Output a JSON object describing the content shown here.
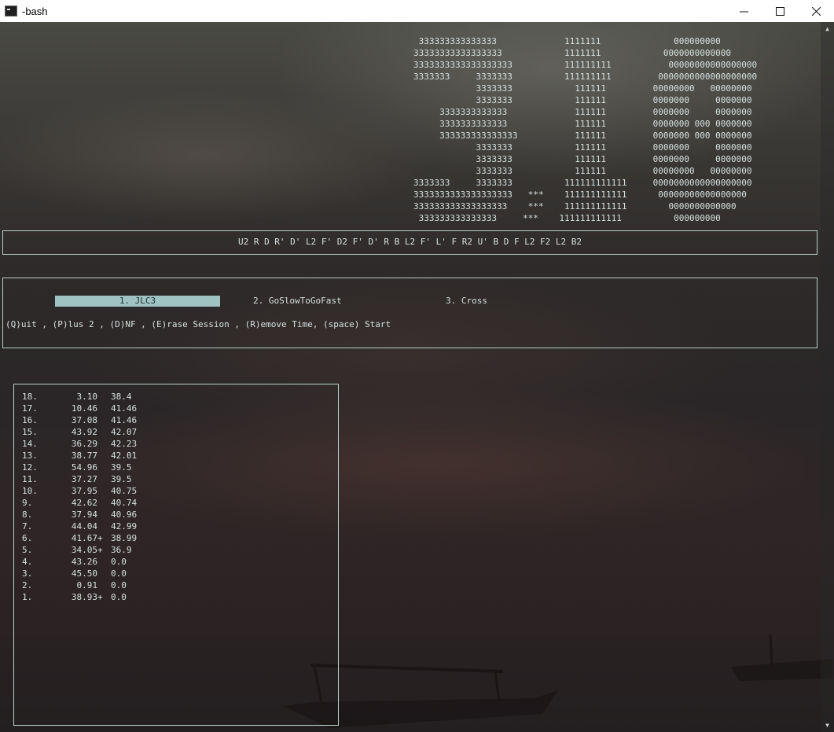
{
  "window": {
    "title": "-bash"
  },
  "logo": {
    "lines": [
      "                                                                                             333333333333333             1111111              000000000",
      "                                                                                            33333333333333333            1111111            0000000000000",
      "                                                                                            3333333333333333333          111111111           00000000000000000",
      "                                                                                            3333333     3333333          111111111         0000000000000000000",
      "                                                                                                        3333333            111111         00000000   00000000",
      "                                                                                                        3333333            111111         0000000     0000000",
      "                                                                                                 3333333333333             111111         0000000     0000000",
      "                                                                                                 3333333333333             111111         0000000 000 0000000",
      "                                                                                                 333333333333333           111111         0000000 000 0000000",
      "                                                                                                        3333333            111111         0000000     0000000",
      "                                                                                                        3333333            111111         0000000     0000000",
      "                                                                                                        3333333            111111         00000000   00000000",
      "                                                                                            3333333     3333333          111111111111     0000000000000000000",
      "                                                                                            3333333333333333333   ***    111111111111      00000000000000000",
      "                                                                                            333333333333333333    ***    111111111111        0000000000000",
      "                                                                                             333333333333333     ***    111111111111          000000000"
    ]
  },
  "scramble": "U2 R D R' D' L2 F' D2 F' D' R B L2 F' L' F R2 U' B D F L2 F2 L2 B2",
  "sessions": [
    {
      "label": "1. JLC3",
      "active": true
    },
    {
      "label": "2. GoSlowToGoFast",
      "active": false
    },
    {
      "label": "3. Cross",
      "active": false
    }
  ],
  "help": "(Q)uit , (P)lus 2 , (D)NF , (E)rase Session , (R)emove Time, (space) Start",
  "times": [
    {
      "idx": "18.",
      "time": "3.10",
      "flag": "",
      "avg": "38.4"
    },
    {
      "idx": "17.",
      "time": "10.46",
      "flag": "",
      "avg": "41.46"
    },
    {
      "idx": "16.",
      "time": "37.08",
      "flag": "",
      "avg": "41.46"
    },
    {
      "idx": "15.",
      "time": "43.92",
      "flag": "",
      "avg": "42.07"
    },
    {
      "idx": "14.",
      "time": "36.29",
      "flag": "",
      "avg": "42.23"
    },
    {
      "idx": "13.",
      "time": "38.77",
      "flag": "",
      "avg": "42.01"
    },
    {
      "idx": "12.",
      "time": "54.96",
      "flag": "",
      "avg": "39.5"
    },
    {
      "idx": "11.",
      "time": "37.27",
      "flag": "",
      "avg": "39.5"
    },
    {
      "idx": "10.",
      "time": "37.95",
      "flag": "",
      "avg": "40.75"
    },
    {
      "idx": "9.",
      "time": "42.62",
      "flag": "",
      "avg": "40.74"
    },
    {
      "idx": "8.",
      "time": "37.94",
      "flag": "",
      "avg": "40.96"
    },
    {
      "idx": "7.",
      "time": "44.04",
      "flag": "",
      "avg": "42.99"
    },
    {
      "idx": "6.",
      "time": "41.67",
      "flag": "+",
      "avg": "38.99"
    },
    {
      "idx": "5.",
      "time": "34.05",
      "flag": "+",
      "avg": "36.9"
    },
    {
      "idx": "4.",
      "time": "43.26",
      "flag": "",
      "avg": "0.0"
    },
    {
      "idx": "3.",
      "time": "45.50",
      "flag": "",
      "avg": "0.0"
    },
    {
      "idx": "2.",
      "time": "0.91",
      "flag": "",
      "avg": "0.0"
    },
    {
      "idx": "1.",
      "time": "38.93",
      "flag": "+",
      "avg": "0.0"
    }
  ],
  "icons": {
    "app": "terminal-icon",
    "minimize": "minimize-icon",
    "maximize": "maximize-icon",
    "close": "close-icon"
  },
  "colors": {
    "text": "#d6e0df",
    "highlight": "#9fc3c3",
    "border": "#b8cfcb"
  }
}
